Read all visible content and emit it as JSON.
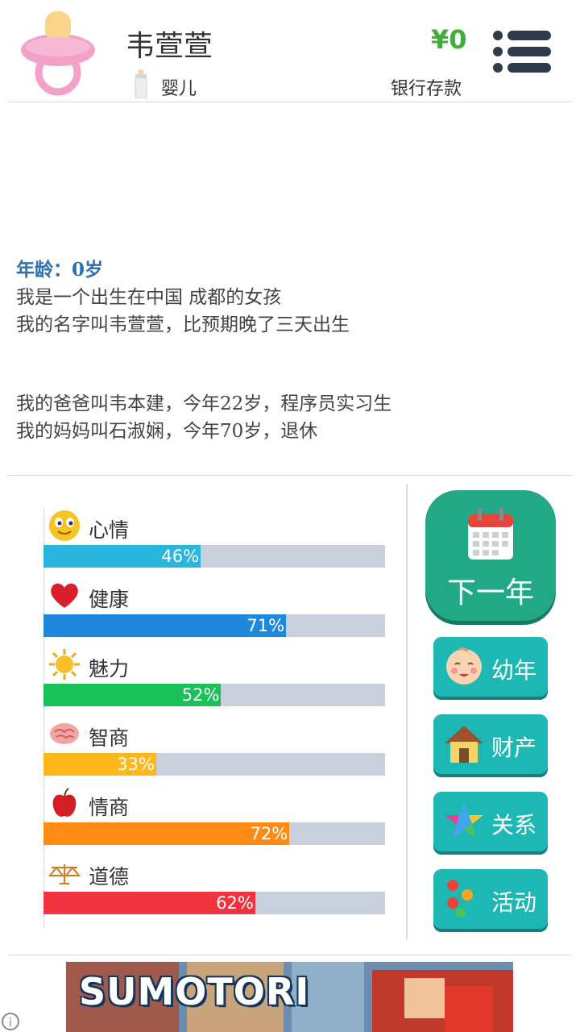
{
  "header": {
    "name": "韦萱萱",
    "stage": "婴儿",
    "money": "¥0",
    "bank_label": "银行存款"
  },
  "story": {
    "age_line": "年龄：0岁",
    "lines_1": [
      "我是一个出生在中国 成都的女孩",
      "我的名字叫韦萱萱，比预期晚了三天出生"
    ],
    "lines_2": [
      "我的爸爸叫韦本建，今年22岁，程序员实习生",
      "我的妈妈叫石淑娴，今年70岁，退休"
    ]
  },
  "stats": [
    {
      "label": "心情",
      "value": 46,
      "pct": "46%",
      "color": "#29b6de",
      "icon": "smiley-icon"
    },
    {
      "label": "健康",
      "value": 71,
      "pct": "71%",
      "color": "#1e88dd",
      "icon": "heart-icon"
    },
    {
      "label": "魅力",
      "value": 52,
      "pct": "52%",
      "color": "#19c159",
      "icon": "sun-icon"
    },
    {
      "label": "智商",
      "value": 33,
      "pct": "33%",
      "color": "#ffb619",
      "icon": "brain-icon"
    },
    {
      "label": "情商",
      "value": 72,
      "pct": "72%",
      "color": "#ff8a14",
      "icon": "apple-icon"
    },
    {
      "label": "道德",
      "value": 62,
      "pct": "62%",
      "color": "#f0333e",
      "icon": "scale-icon"
    }
  ],
  "actions": {
    "next_year": "下一年",
    "childhood": "幼年",
    "property": "财产",
    "relations": "关系",
    "activities": "活动"
  },
  "ad": {
    "title": "SUMOTORI"
  }
}
